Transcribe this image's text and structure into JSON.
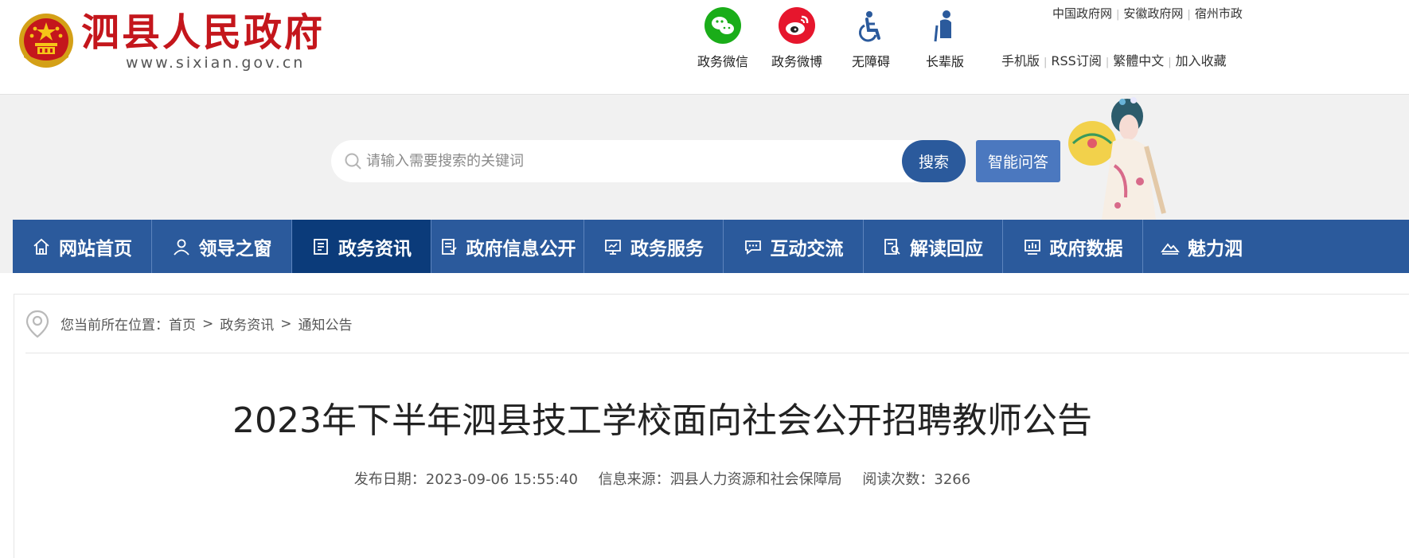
{
  "header": {
    "site_name": "泗县人民政府",
    "site_url": "www.sixian.gov.cn",
    "quick_links": [
      {
        "label": "政务微信",
        "icon": "wechat-icon",
        "color": "#1aad19"
      },
      {
        "label": "政务微博",
        "icon": "weibo-icon",
        "color": "#e6162d"
      },
      {
        "label": "无障碍",
        "icon": "wheelchair-icon",
        "color": "#2b5a9c"
      },
      {
        "label": "长辈版",
        "icon": "elder-icon",
        "color": "#2b5a9c"
      }
    ],
    "top_links": [
      "中国政府网",
      "安徽政府网",
      "宿州市政"
    ],
    "tools": [
      "手机版",
      "RSS订阅",
      "繁體中文",
      "加入收藏"
    ]
  },
  "search": {
    "placeholder": "请输入需要搜索的关键词",
    "button": "搜索",
    "ai_button": "智能问答"
  },
  "nav": {
    "items": [
      {
        "label": "网站首页",
        "icon": "home-icon"
      },
      {
        "label": "领导之窗",
        "icon": "person-icon"
      },
      {
        "label": "政务资讯",
        "icon": "document-icon",
        "active": true
      },
      {
        "label": "政府信息公开",
        "icon": "list-document-icon"
      },
      {
        "label": "政务服务",
        "icon": "monitor-icon"
      },
      {
        "label": "互动交流",
        "icon": "chat-icon"
      },
      {
        "label": "解读回应",
        "icon": "search-document-icon"
      },
      {
        "label": "政府数据",
        "icon": "chart-icon"
      },
      {
        "label": "魅力泗",
        "icon": "landscape-icon"
      }
    ]
  },
  "breadcrumb": {
    "prefix": "您当前所在位置：",
    "items": [
      "首页",
      "政务资讯",
      "通知公告"
    ]
  },
  "article": {
    "title": "2023年下半年泗县技工学校面向社会公开招聘教师公告",
    "date_label": "发布日期：",
    "date": "2023-09-06 15:55:40",
    "source_label": "信息来源：",
    "source": "泗县人力资源和社会保障局",
    "views_label": "阅读次数：",
    "views": "3266"
  },
  "colors": {
    "brand_red": "#c4161c",
    "nav_blue": "#2b5a9c",
    "nav_active": "#0b3b7a",
    "ai_blue": "#4b78bf"
  }
}
